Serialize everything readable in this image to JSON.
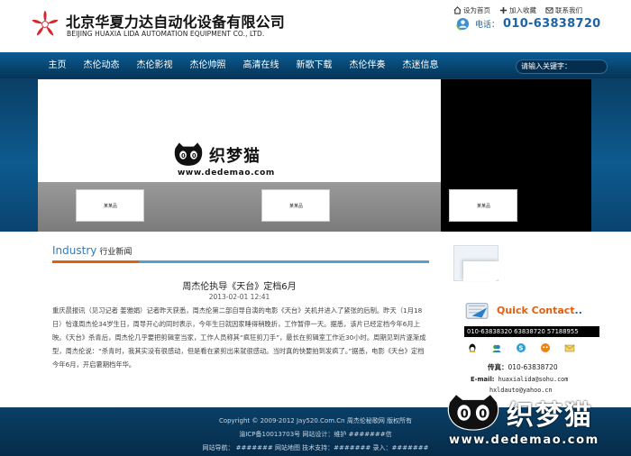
{
  "header": {
    "company_cn": "北京华夏力达自动化设备有限公司",
    "company_en": "BEIJING HUAXIA LIDA AUTOMATION EQUIPMENT CO., LTD.",
    "links": {
      "homepage": "设为首页",
      "favorite": "加入收藏",
      "contact": "联系我们"
    },
    "phone_label": "电话：",
    "phone_number": "010-63838720"
  },
  "nav": {
    "items": [
      "主页",
      "杰伦动态",
      "杰伦影视",
      "杰伦帅照",
      "高清在线",
      "新歌下载",
      "杰伦伴奏",
      "杰迷信息"
    ],
    "search_placeholder": "请输入关键字："
  },
  "banner": {
    "watermark_cn": "织梦猫",
    "watermark_url": "www.dedemao.com",
    "thumb_caption": "某某品"
  },
  "section": {
    "title_en": "Industry",
    "title_cn": "行业新闻"
  },
  "article": {
    "title": "周杰伦执导《天台》定档6月",
    "date": "2013-02-01 12:41",
    "body": "重庆晨报讯（见习记者 姜雅娟）记者昨天获悉，周杰伦第二部自导自演的电影《天台》关机并进入了紧张的后制。昨天（1月18日）恰逢周杰伦34岁生日，周导开心的同时表示，今年生日就因家睡得稍晚折，工作暂停一天。据悉，该片已经定档今年6月上映。《天台》杀青后，周杰伦几乎要把剪辑室当家，工作人员称其“疯狂剪刀手”，最长在剪辑室工作近30小时。周期见到片逐渐成型，周杰伦说：“杀青时，我其实没有很感动，但是看在紧剪出来就很感动。当时真的快要拍到发疯了。”据悉，电影《天台》定档今年6月，开启暑期档年华。"
  },
  "sidebar": {
    "quick_contact": "Quick Contact",
    "quick_contact_dots": "..",
    "phones": "010-63838320  63838720  57188955",
    "fax_label": "传真：",
    "fax_number": "010-63838720",
    "email_label": "E-mail:",
    "email1": "huaxialida@sohu.com",
    "email2": "hxldauto@yahoo.cn",
    "icons": [
      "qq-icon",
      "msn-icon",
      "skype-icon",
      "wangwang-icon",
      "email-icon"
    ]
  },
  "footer": {
    "copyright": "Copyright © 2009-2012 Jay520.Com.Cn 周杰伦秘歌网 版权所有",
    "icp": "渝ICP备10013703号 网站设计：维护 #######信",
    "links": "网站导航： ####### 网站地图 技术支持：####### 录入：#######"
  },
  "colors": {
    "nav_bg": "#07436d",
    "accent": "#e06010",
    "link_blue": "#1d63a5"
  }
}
